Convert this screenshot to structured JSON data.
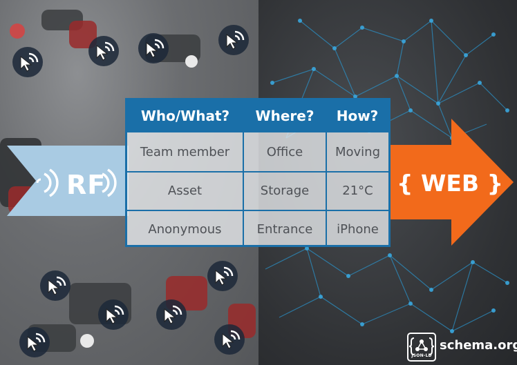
{
  "diagram": {
    "input_label": "RF",
    "output_label": "{ WEB }",
    "colors": {
      "table_blue": "#1a6fa8",
      "rf_arrow": "#a9cbe3",
      "web_arrow": "#f26a1b",
      "badge": "#1c2838"
    }
  },
  "table": {
    "headers": [
      "Who/What?",
      "Where?",
      "How?"
    ],
    "rows": [
      [
        "Team member",
        "Office",
        "Moving"
      ],
      [
        "Asset",
        "Storage",
        "21°C"
      ],
      [
        "Anonymous",
        "Entrance",
        "iPhone"
      ]
    ]
  },
  "logo": {
    "text": "schema.org",
    "badge_text": "JSON-LD"
  },
  "icons": [
    "wifi-cursor-icon",
    "rf-signal-icon",
    "json-ld-icon"
  ]
}
